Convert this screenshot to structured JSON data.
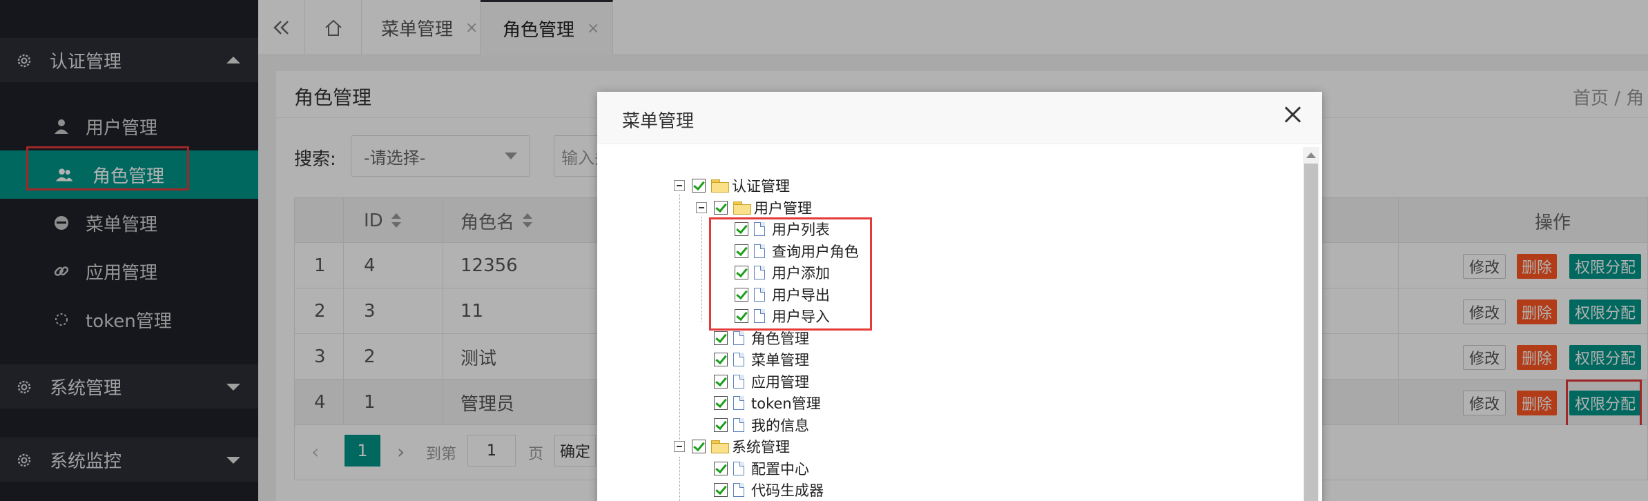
{
  "sidebar": {
    "groups": [
      {
        "label": "认证管理",
        "expanded": true
      },
      {
        "label": "系统管理",
        "expanded": false
      },
      {
        "label": "系统监控",
        "expanded": false
      }
    ],
    "items": [
      {
        "label": "用户管理",
        "icon": "user-icon"
      },
      {
        "label": "角色管理",
        "icon": "users-icon",
        "active": true
      },
      {
        "label": "菜单管理",
        "icon": "menu-circle-icon"
      },
      {
        "label": "应用管理",
        "icon": "link-icon"
      },
      {
        "label": "token管理",
        "icon": "spinner-icon"
      }
    ]
  },
  "topbar": {
    "tabs": [
      {
        "label": "菜单管理",
        "close": "×"
      },
      {
        "label": "角色管理",
        "close": "×",
        "active": true
      }
    ]
  },
  "page": {
    "title": "角色管理",
    "breadcrumb": "首页  /  角"
  },
  "search": {
    "label": "搜索:",
    "select_value": "-请选择-",
    "input_placeholder": "输入关"
  },
  "table": {
    "columns": [
      "",
      "ID",
      "角色名",
      "操作"
    ],
    "rows": [
      {
        "index": "1",
        "id": "4",
        "name": "12356"
      },
      {
        "index": "2",
        "id": "3",
        "name": "11"
      },
      {
        "index": "3",
        "id": "2",
        "name": "测试"
      },
      {
        "index": "4",
        "id": "1",
        "name": "管理员"
      }
    ],
    "actions": {
      "edit": "修改",
      "delete": "删除",
      "permission": "权限分配"
    }
  },
  "pager": {
    "prev": "‹",
    "current": "1",
    "next": "›",
    "goto_label": "到第",
    "input_value": "1",
    "page_label": "页",
    "confirm": "确定"
  },
  "modal": {
    "title": "菜单管理",
    "tree": {
      "auth": "认证管理",
      "user_mgmt": "用户管理",
      "user_list": "用户列表",
      "query_user_role": "查询用户角色",
      "user_add": "用户添加",
      "user_export": "用户导出",
      "user_import": "用户导入",
      "role_mgmt": "角色管理",
      "menu_mgmt": "菜单管理",
      "app_mgmt": "应用管理",
      "token_mgmt": "token管理",
      "my_info": "我的信息",
      "sys_mgmt": "系统管理",
      "config_center": "配置中心",
      "code_gen": "代码生成器"
    }
  },
  "colors": {
    "sidebar_bg": "#20222a",
    "accent": "#009688",
    "danger": "#ff5722",
    "highlight_box": "#e5393a"
  }
}
